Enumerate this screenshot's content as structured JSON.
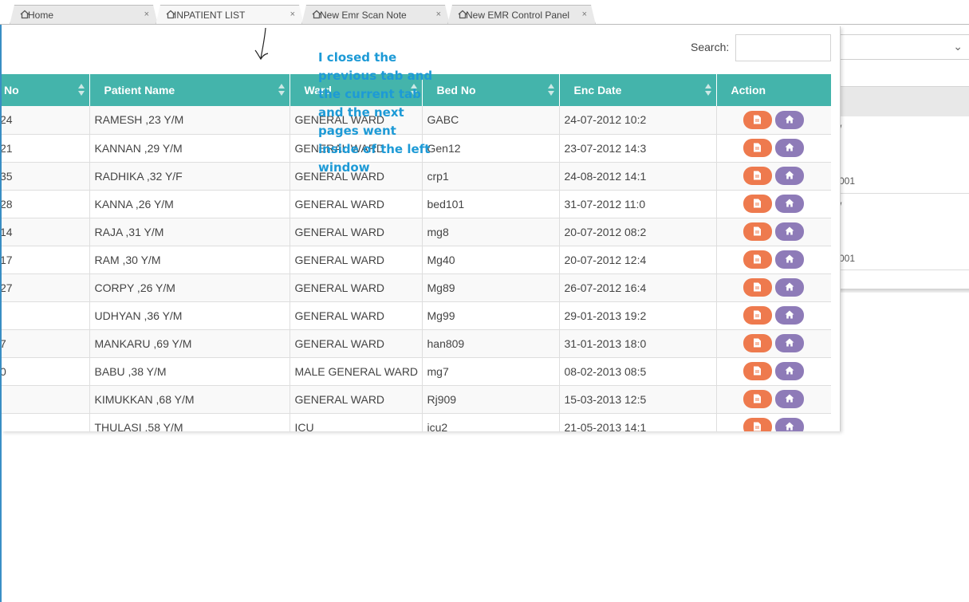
{
  "tabs": [
    {
      "label": "Home",
      "active": false
    },
    {
      "label": "INPATIENT LIST",
      "active": true
    },
    {
      "label": "New Emr Scan Note",
      "active": false
    },
    {
      "label": "New EMR Control Panel",
      "active": false
    }
  ],
  "tab_close_glyph": "×",
  "search": {
    "label": "Search:",
    "value": ""
  },
  "table": {
    "columns": [
      "No",
      "Patient Name",
      "Ward",
      "Bed No",
      "Enc Date",
      "Action"
    ],
    "rows": [
      {
        "no": "24",
        "name": "RAMESH ,23 Y/M",
        "ward": "GENERAL WARD",
        "bed": "GABC",
        "date": "24-07-2012 10:2"
      },
      {
        "no": "21",
        "name": "KANNAN ,29 Y/M",
        "ward": "GENERAL WARD",
        "bed": "Gen12",
        "date": "23-07-2012 14:3"
      },
      {
        "no": "35",
        "name": "RADHIKA ,32 Y/F",
        "ward": "GENERAL WARD",
        "bed": "crp1",
        "date": "24-08-2012 14:1"
      },
      {
        "no": "28",
        "name": "KANNA ,26 Y/M",
        "ward": "GENERAL WARD",
        "bed": "bed101",
        "date": "31-07-2012 11:0"
      },
      {
        "no": "14",
        "name": "RAJA ,31 Y/M",
        "ward": "GENERAL WARD",
        "bed": "mg8",
        "date": "20-07-2012 08:2"
      },
      {
        "no": "17",
        "name": "RAM ,30 Y/M",
        "ward": "GENERAL WARD",
        "bed": "Mg40",
        "date": "20-07-2012 12:4"
      },
      {
        "no": "27",
        "name": "CORPY ,26 Y/M",
        "ward": "GENERAL WARD",
        "bed": "Mg89",
        "date": "26-07-2012 16:4"
      },
      {
        "no": "",
        "name": "UDHYAN ,36 Y/M",
        "ward": "GENERAL WARD",
        "bed": "Mg99",
        "date": "29-01-2013 19:2"
      },
      {
        "no": "7",
        "name": "MANKARU ,69 Y/M",
        "ward": "GENERAL WARD",
        "bed": "han809",
        "date": "31-01-2013 18:0"
      },
      {
        "no": "0",
        "name": "BABU ,38 Y/M",
        "ward": "MALE GENERAL WARD",
        "bed": "mg7",
        "date": "08-02-2013 08:5"
      },
      {
        "no": "",
        "name": "KIMUKKAN ,68 Y/M",
        "ward": "GENERAL WARD",
        "bed": "Rj909",
        "date": "15-03-2013 12:5"
      },
      {
        "no": "",
        "name": "THULASI ,58 Y/M",
        "ward": "ICU",
        "bed": "icu2",
        "date": "21-05-2013 14:1"
      }
    ]
  },
  "background_window": {
    "row_text_1": "/",
    "row_code_1": "001",
    "row_text_2": "/",
    "row_code_2": "001"
  },
  "annotation": "I closed the previous tab and the current tab and the next pages went inside of the left window",
  "colors": {
    "header": "#44b4ab",
    "doc_button": "#ee7a4e",
    "home_button": "#8e7bb8",
    "annotation": "#1d9ad6"
  },
  "icons": {
    "tab": "home-icon",
    "action_1": "document-icon",
    "action_2": "home-icon"
  }
}
